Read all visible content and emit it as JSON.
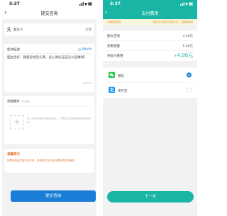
{
  "left": {
    "status_time": "5:37",
    "title": "提交咨询",
    "patient": {
      "label": "就诊人",
      "value": "刘港"
    },
    "desc": {
      "title": "症状描述",
      "example": "查看示例",
      "text": "医生您好，我最近经常头晕，恶心请问这是怎么回事啊？",
      "count": "28/300"
    },
    "images": {
      "title": "添加图片",
      "optional": "(可选填)",
      "hint": "请上传有效病历或检查图片，方便医生准确判断病情(最多9张)"
    },
    "tips": {
      "title": "温馨提示",
      "text": "如果没有医生接诊的订单，系统将在当日自动退款并进行通知。"
    },
    "submit": "提交咨询"
  },
  "right": {
    "status_time": "5:37",
    "title": "支付费用",
    "notice_left": "订单即将失效",
    "notice_right": "请在15分钟内完成支付，过期将取消",
    "fees": [
      {
        "label": "图文咨询",
        "value": "4.00元"
      },
      {
        "label": "优惠金额",
        "value": "0.00元"
      }
    ],
    "payable_label": "待支付费用",
    "payable_currency": "¥",
    "payable_amount": "4.00元",
    "methods": [
      {
        "name": "微信",
        "selected": true
      },
      {
        "name": "支付宝",
        "selected": false
      }
    ],
    "next": "下一步"
  },
  "colors": {
    "blue": "#1a7ed8",
    "teal": "#19b5a5",
    "orange": "#e8763a",
    "wechat": "#28c445",
    "alipay": "#1a9ef0"
  }
}
